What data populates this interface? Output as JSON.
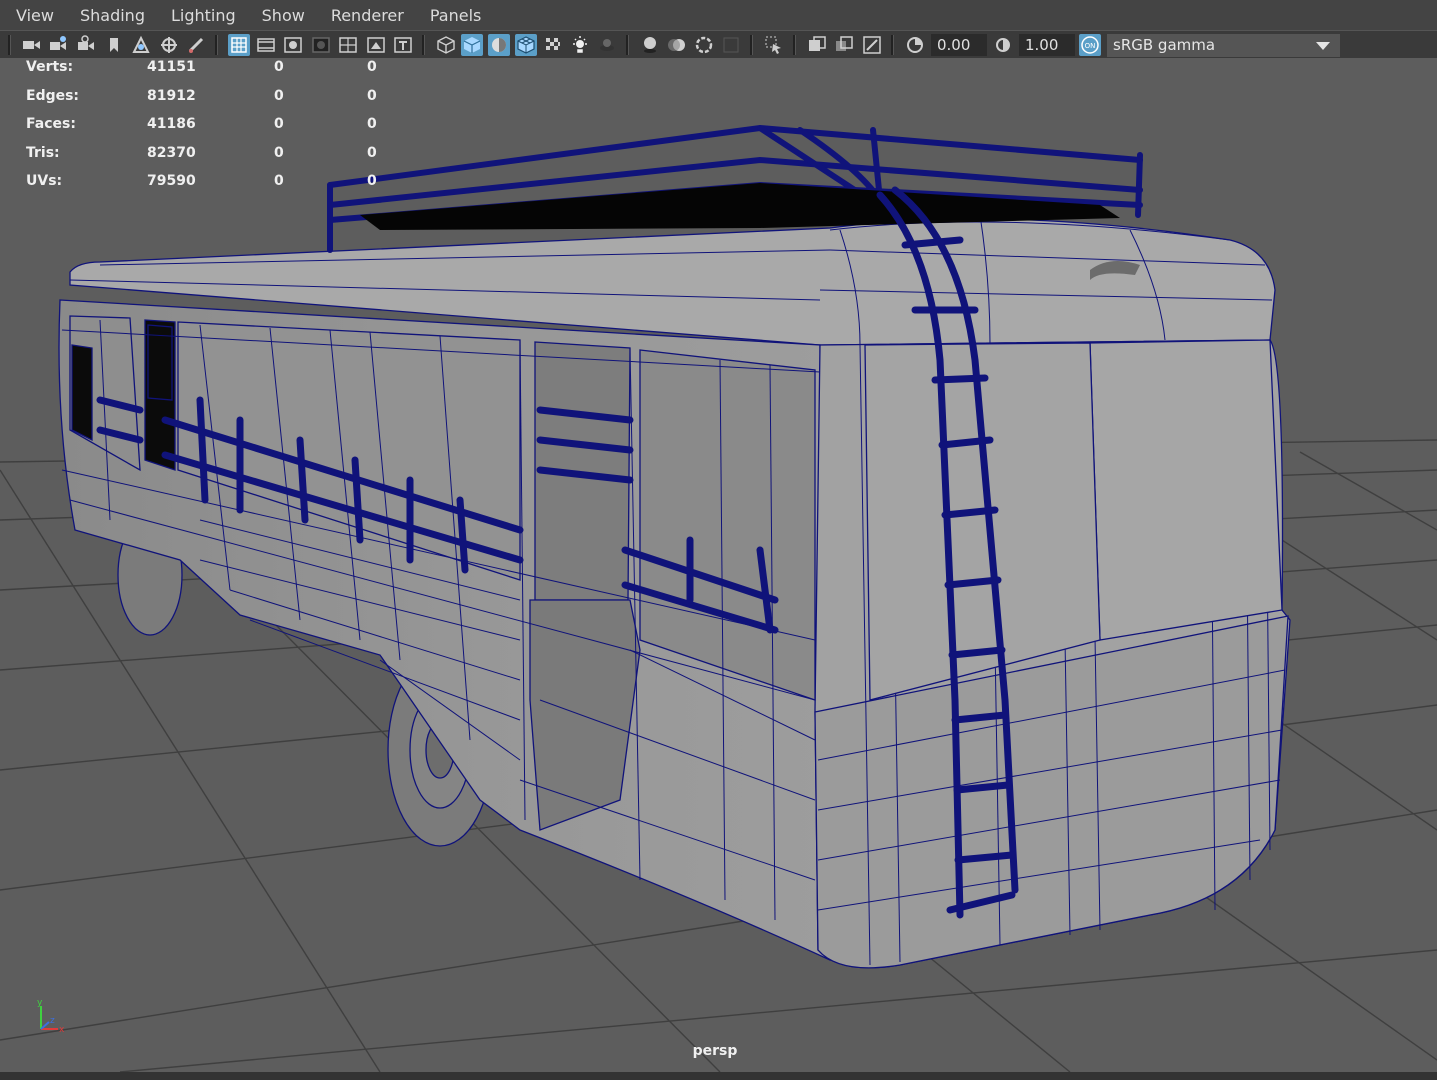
{
  "menu": [
    "View",
    "Shading",
    "Lighting",
    "Show",
    "Renderer",
    "Panels"
  ],
  "toolbar": {
    "exposure_value": "0.00",
    "gamma_value": "1.00",
    "color_space": "sRGB gamma"
  },
  "hud": {
    "rows": [
      {
        "label": "Verts:",
        "total": "41151",
        "selected": "0",
        "component": "0"
      },
      {
        "label": "Edges:",
        "total": "81912",
        "selected": "0",
        "component": "0"
      },
      {
        "label": "Faces:",
        "total": "41186",
        "selected": "0",
        "component": "0"
      },
      {
        "label": "Tris:",
        "total": "82370",
        "selected": "0",
        "component": "0"
      },
      {
        "label": "UVs:",
        "total": "79590",
        "selected": "0",
        "component": "0"
      }
    ]
  },
  "viewport": {
    "camera": "persp",
    "wire_color": "#10137a",
    "grid_color": "#3e3e3e",
    "background": "#5d5d5d"
  },
  "axis": {
    "y": "y",
    "x": "x",
    "z": "z"
  }
}
